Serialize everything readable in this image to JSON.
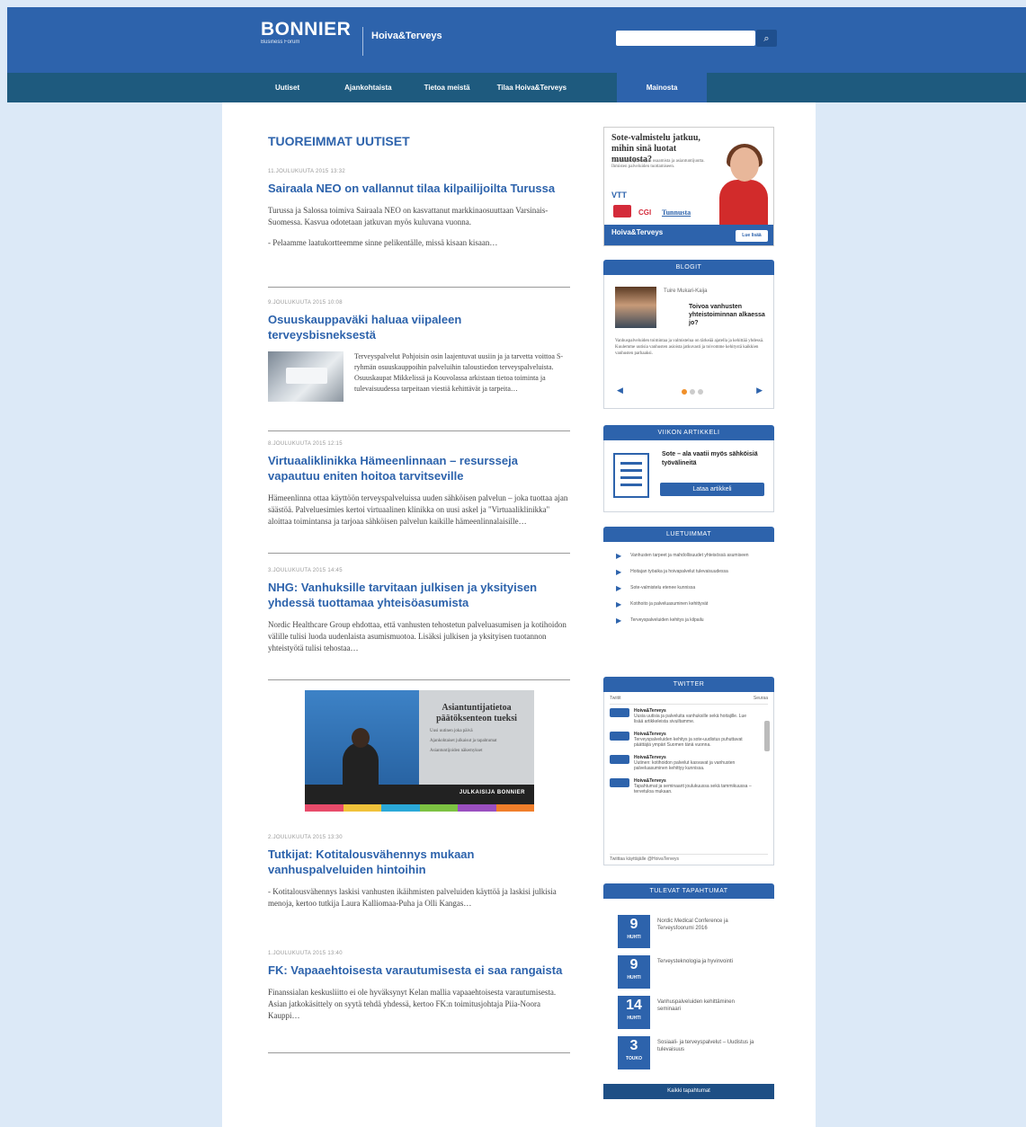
{
  "header": {
    "logo": "BONNIER",
    "logo_sub": "Business Forum",
    "brand": "Hoiva&Terveys",
    "brand_sub": "",
    "search_placeholder": ""
  },
  "nav": {
    "items": [
      {
        "label": "Uutiset"
      },
      {
        "label": "Ajankohtaista"
      },
      {
        "label": "Tietoa meistä"
      },
      {
        "label": "Tilaa Hoiva&Terveys"
      },
      {
        "label": "Mainosta"
      }
    ]
  },
  "main": {
    "section_title": "TUOREIMMAT UUTISET",
    "articles": [
      {
        "date": "11.JOULUKUUTA 2015 13:32",
        "title": "Sairaala NEO on vallannut tilaa kilpailijoilta Turussa",
        "p1": "Turussa ja Salossa toimiva Sairaala NEO on kasvattanut markkinaosuuttaan Varsinais-Suomessa. Kasvua odotetaan jatkuvan myös kuluvana vuonna.",
        "p2": "- Pelaamme laatukortteemme sinne pelikentälle, missä kisaan kisaan…"
      },
      {
        "date": "9.JOULUKUUTA 2015 10:08",
        "title": "Osuuskauppaväki haluaa viipaleen terveysbisneksestä",
        "text": "Terveyspalvelut Pohjoisin osin laajentuvat uusiin ja ja tarvetta voittoa S-ryhmän osuuskauppoihin palveluihin taloustiedon terveyspalveluista. Osuuskaupat Mikkelissä ja Kouvolassa arkistaan tietoa toiminta ja tulevaisuudessa tarpeitaan viestiä kehittävät ja tarpeita…"
      },
      {
        "date": "8.JOULUKUUTA 2015 12:15",
        "title": "Virtuaaliklinikka Hämeenlinnaan – resursseja vapautuu eniten hoitoa tarvitseville",
        "text": "Hämeenlinna ottaa käyttöön terveyspalveluissa uuden sähköisen palvelun – joka tuottaa ajan säästöä. Palveluesimies kertoi virtuaalinen klinikka on uusi askel ja \"Virtuaaliklinikka\" aloittaa toimintansa ja tarjoaa sähköisen palvelun kaikille hämeenlinnalaisille…"
      },
      {
        "date": "3.JOULUKUUTA 2015 14:45",
        "title": "NHG: Vanhuksille tarvitaan julkisen ja yksityisen yhdessä tuottamaa yhteisöasumista",
        "text": "Nordic Healthcare Group ehdottaa, että vanhusten tehostetun palveluasumisen ja kotihoidon välille tulisi luoda uudenlaista asumismuotoa. Lisäksi julkisen ja yksityisen tuotannon yhteistyötä tulisi tehostaa…"
      },
      {
        "date": "2.JOULUKUUTA 2015 13:30",
        "title": "Tutkijat: Kotitalousvähennys mukaan vanhuspalveluiden hintoihin",
        "text": "- Kotitalousvähennys laskisi vanhusten ikäihmisten palveluiden käyttöä ja laskisi julkisia menoja, kertoo tutkija Laura Kalliomaa-Puha ja Olli Kangas…"
      },
      {
        "date": "1.JOULUKUUTA 2015 13:40",
        "title": "FK: Vapaaehtoisesta varautumisesta ei saa rangaista",
        "text": "Finanssialan keskusliitto ei ole hyväksynyt Kelan mallia vapaaehtoisesta varautumisesta. Asian jatkokäsittely on syytä tehdä yhdessä, kertoo FK:n toimitusjohtaja Piia-Noora Kauppi…"
      }
    ]
  },
  "ad_mid": {
    "title": "Asiantuntijatietoa päätöksenteon tueksi",
    "bullets": [
      "Uusi uutinen joka päivä",
      "Ajankohtaiset julkaisut ja tapahtumat",
      "Asiantuntijoiden näkemykset"
    ],
    "band": "JULKAISIJA BONNIER",
    "colors": [
      "#e84b6a",
      "#f0c23a",
      "#2aa8d8",
      "#7cc242",
      "#9a4fc0",
      "#f07e2a"
    ]
  },
  "sidebar": {
    "ad_top": {
      "title": "Sote-valmistelu jatkuu, mihin sinä luotat muutosta?",
      "sub": "Tarvitaanko parempaa osaamista ja asiantuntijuutta. Ihmisten palveluiden tuottamiseen.",
      "logo1": "VTT",
      "cgi": "CGI",
      "tunnus": "Tunnusta",
      "band": "Hoiva&Terveys",
      "cta": "Lue lisää"
    },
    "blog": {
      "head": "BLOGIT",
      "author": "Tuire Mukari-Kaija",
      "title": "Toivoa vanhusten yhteistoiminnan alkaessa jo?",
      "text": "Vanhuspalveluiden toimintaa ja valmistelua on tärkeää ajatella ja kehittää yhdessä. Kuulemme uutisia vanhusten asioista jatkuvasti ja toivomme kehitystä kaikkien vanhusten parhaaksi.",
      "prev": "◀",
      "next": "▶"
    },
    "featured": {
      "head": "VIIKON ARTIKKELI",
      "title": "Sote – ala vaatii myös sähköisiä työvälineitä",
      "button": "Lataa artikkeli"
    },
    "most_read": {
      "head": "LUETUIMMAT",
      "items": [
        "Vanhusten tarpeet ja mahdollisuudet yhteisössä asumiseen",
        "Hoitajan työaika ja hoivapalvelut tulevaisuudessa",
        "Sote-valmistelu etenee kunnissa",
        "Kotihoito ja palveluasuminen kehittyvät",
        "Terveyspalveluiden kehitys ja kilpailu"
      ]
    },
    "twitter": {
      "head": "TWITTER",
      "tweets_label": "Twiitit",
      "follow_label": "Seuraa",
      "tweets": [
        {
          "name": "Hoiva&Terveys",
          "text": "Uusia uutisia ja palveluita vanhuksille sekä hoitajille. Lue lisää artikkeleista sivuiltamme."
        },
        {
          "name": "Hoiva&Terveys",
          "text": "Terveyspalveluiden kehitys ja sote-uudistus puhuttavat päättäjiä ympäri Suomen tänä vuonna."
        },
        {
          "name": "Hoiva&Terveys",
          "text": "Uutinen: kotihoidon palvelut kasvavat ja vanhusten palveluasuminen kehittyy kunnissa."
        },
        {
          "name": "Hoiva&Terveys",
          "text": "Tapahtumat ja seminaarit joulukuussa sekä tammikuussa – tervetuloa mukaan."
        }
      ],
      "foot": "Twiittaa käyttäjälle @HoivaTerveys"
    },
    "events": {
      "head": "TULEVAT TAPAHTUMAT",
      "items": [
        {
          "day": "9",
          "month": "HUHTI",
          "text": "Nordic Medical Conference ja Terveysfoorumi 2016"
        },
        {
          "day": "9",
          "month": "HUHTI",
          "text": "Terveysteknologia ja hyvinvointi"
        },
        {
          "day": "14",
          "month": "HUHTI",
          "text": "Vanhuspalveluiden kehittäminen seminaari"
        },
        {
          "day": "3",
          "month": "TOUKO",
          "text": "Sosiaali- ja terveyspalvelut – Uudistus ja tulevaisuus"
        }
      ],
      "more": "Kaikki tapahtumat"
    }
  }
}
